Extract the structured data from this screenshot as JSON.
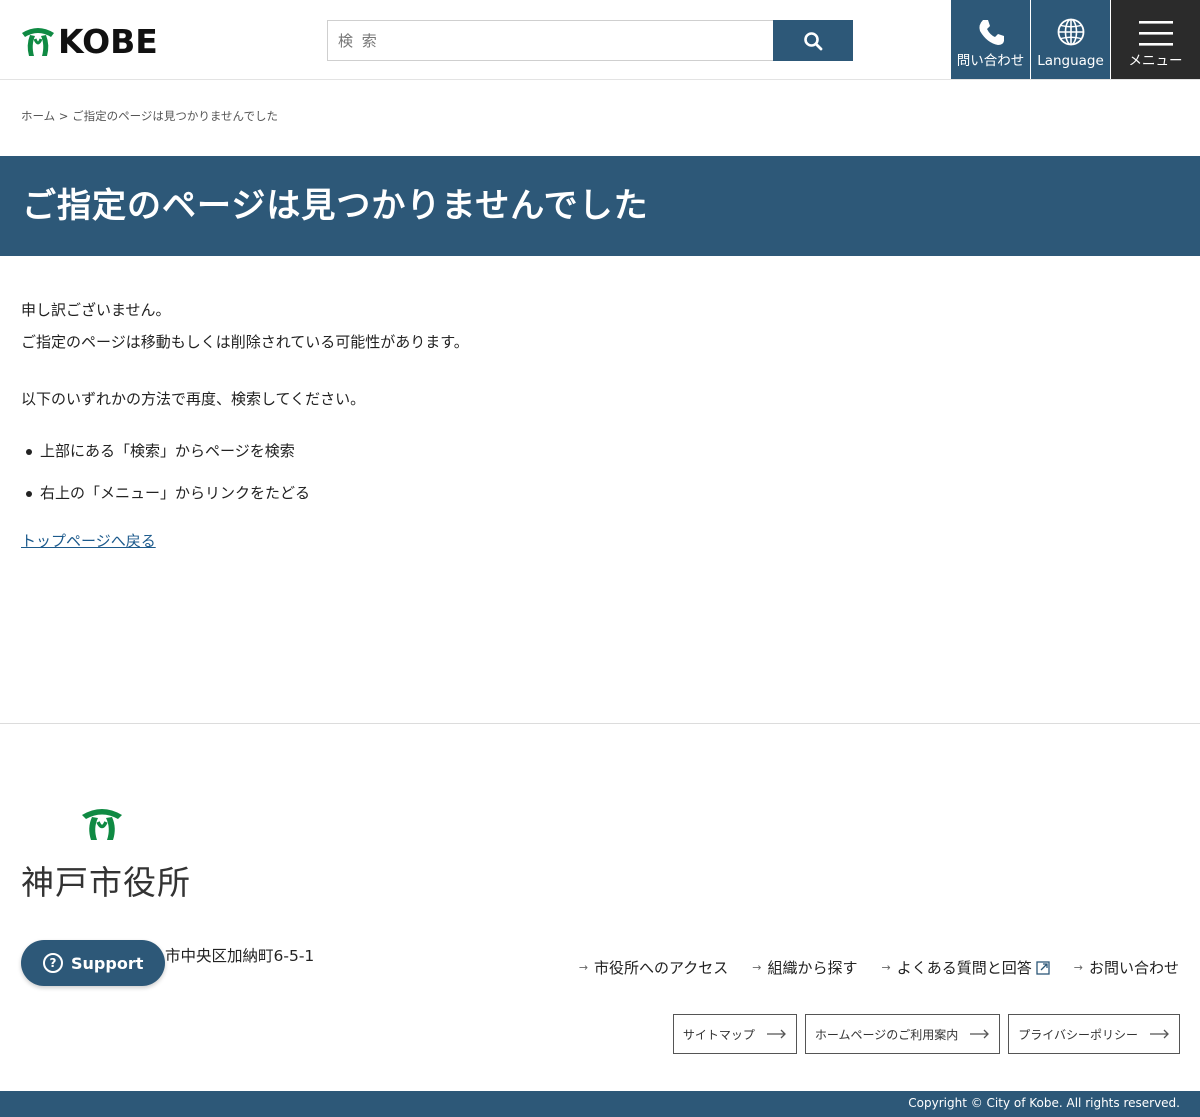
{
  "header": {
    "logo_text": "KOBE",
    "search_placeholder": "検 索",
    "contact_label": "問い合わせ",
    "language_label": "Language",
    "menu_label": "メニュー"
  },
  "breadcrumb": {
    "home": "ホーム",
    "separator": " > ",
    "current": "ご指定のページは見つかりませんでした"
  },
  "page": {
    "title": "ご指定のページは見つかりませんでした",
    "line1": "申し訳ございません。",
    "line2": "ご指定のページは移動もしくは削除されている可能性があります。",
    "line3": "以下のいずれかの方法で再度、検索してください。",
    "bullets": [
      "上部にある「検索」からページを検索",
      "右上の「メニュー」からリンクをたどる"
    ],
    "back_link": "トップページへ戻る"
  },
  "footer": {
    "org_name": "神戸市役所",
    "address_visible": "市中央区加納町6-5-1",
    "support_label": "Support",
    "links": [
      "市役所へのアクセス",
      "組織から探す",
      "よくある質問と回答",
      "お問い合わせ"
    ],
    "buttons": [
      "サイトマップ",
      "ホームページのご利用案内",
      "プライバシーポリシー"
    ],
    "copyright": "Copyright © City of Kobe. All rights reserved."
  },
  "colors": {
    "brand_navy": "#2d5878",
    "menu_dark": "#2b2b2b",
    "logo_green": "#0f8a43",
    "link_blue": "#1c5a8c"
  }
}
